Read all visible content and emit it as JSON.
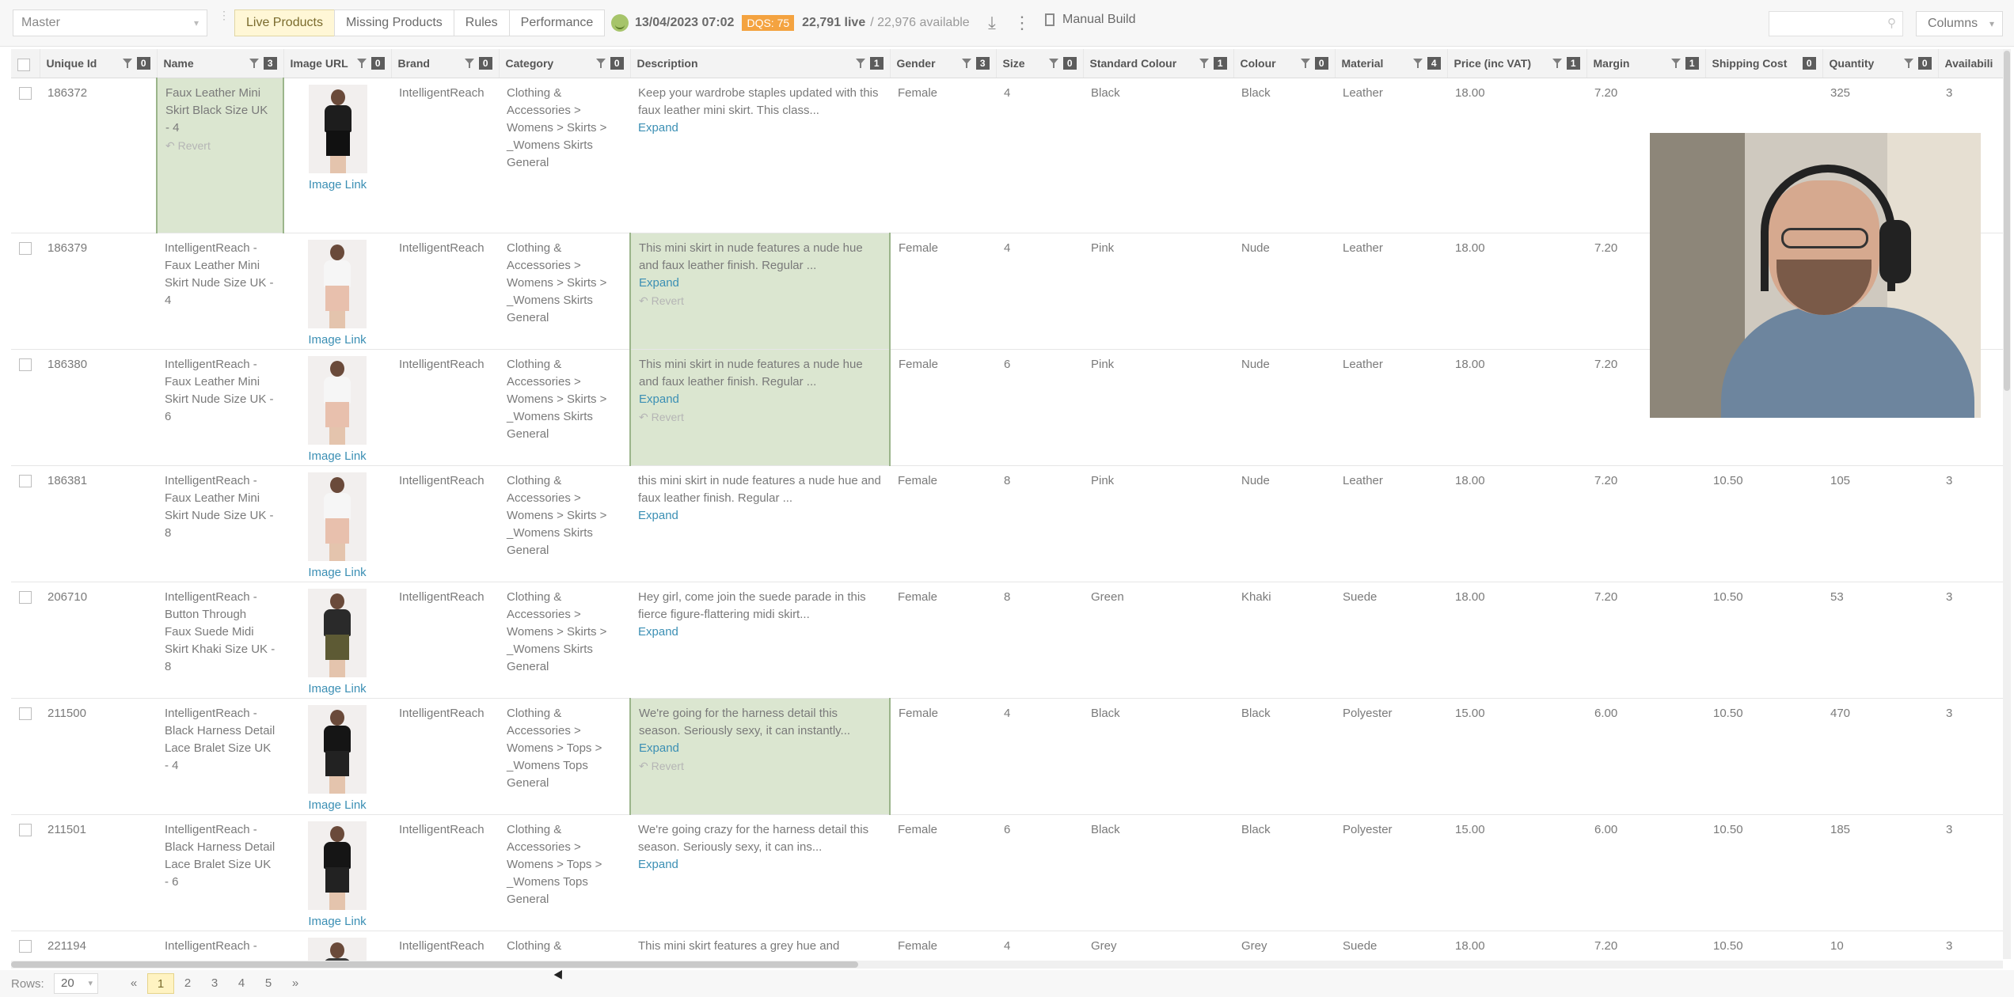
{
  "toolbar": {
    "master_select": "Master",
    "tabs": [
      "Live Products",
      "Missing Products",
      "Rules",
      "Performance"
    ],
    "status_date": "13/04/2023 07:02",
    "dqs": "DQS: 75",
    "live_count": "22,791 live",
    "available_text": "/ 22,976 available",
    "manual_build": "Manual Build",
    "search_placeholder": "",
    "columns_label": "Columns"
  },
  "columns": [
    {
      "label": "Unique Id",
      "badge": "0"
    },
    {
      "label": "Name",
      "badge": "3"
    },
    {
      "label": "Image URL",
      "badge": "0"
    },
    {
      "label": "Brand",
      "badge": "0"
    },
    {
      "label": "Category",
      "badge": "0"
    },
    {
      "label": "Description",
      "badge": "1"
    },
    {
      "label": "Gender",
      "badge": "3"
    },
    {
      "label": "Size",
      "badge": "0"
    },
    {
      "label": "Standard Colour",
      "badge": "1"
    },
    {
      "label": "Colour",
      "badge": "0"
    },
    {
      "label": "Material",
      "badge": "4"
    },
    {
      "label": "Price (inc VAT)",
      "badge": "1"
    },
    {
      "label": "Margin",
      "badge": "1"
    },
    {
      "label": "Shipping Cost",
      "badge": "0"
    },
    {
      "label": "Quantity",
      "badge": "0"
    },
    {
      "label": "Availabili",
      "badge": ""
    }
  ],
  "rows": [
    {
      "id": "186372",
      "name": "Faux Leather Mini Skirt Black Size UK - 4",
      "name_revert": "↶ Revert",
      "image_link": "Image Link",
      "brand": "IntelligentReach",
      "category": "Clothing & Accessories > Womens > Skirts > _Womens Skirts General",
      "description": "Keep your wardrobe staples updated with this faux leather mini skirt. This class...",
      "desc_expand": "Expand",
      "desc_revert": "",
      "gender": "Female",
      "size": "4",
      "std_colour": "Black",
      "colour": "Black",
      "material": "Leather",
      "price": "18.00",
      "margin": "7.20",
      "shipping": "",
      "quantity": "325",
      "availability": "3",
      "img_top": "#1d1d1d",
      "img_skirt": "#111111"
    },
    {
      "id": "186379",
      "name": "IntelligentReach - Faux Leather Mini Skirt Nude Size UK - 4",
      "name_revert": "",
      "image_link": "Image Link",
      "brand": "IntelligentReach",
      "category": "Clothing & Accessories > Womens > Skirts > _Womens Skirts General",
      "description": "This mini skirt in nude features a nude hue and faux leather finish.   Regular ...",
      "desc_expand": "Expand",
      "desc_revert": "↶ Revert",
      "gender": "Female",
      "size": "4",
      "std_colour": "Pink",
      "colour": "Nude",
      "material": "Leather",
      "price": "18.00",
      "margin": "7.20",
      "shipping": "",
      "quantity": "",
      "availability": "",
      "img_top": "#f6f6f6",
      "img_skirt": "#e8c0ad"
    },
    {
      "id": "186380",
      "name": "IntelligentReach - Faux Leather Mini Skirt Nude Size UK - 6",
      "name_revert": "",
      "image_link": "Image Link",
      "brand": "IntelligentReach",
      "category": "Clothing & Accessories > Womens > Skirts > _Womens Skirts General",
      "description": "This mini skirt in nude features a nude hue and faux leather finish.   Regular ...",
      "desc_expand": "Expand",
      "desc_revert": "↶ Revert",
      "gender": "Female",
      "size": "6",
      "std_colour": "Pink",
      "colour": "Nude",
      "material": "Leather",
      "price": "18.00",
      "margin": "7.20",
      "shipping": "",
      "quantity": "",
      "availability": "",
      "img_top": "#f6f6f6",
      "img_skirt": "#e8c0ad"
    },
    {
      "id": "186381",
      "name": "IntelligentReach - Faux Leather Mini Skirt Nude Size UK - 8",
      "name_revert": "",
      "image_link": "Image Link",
      "brand": "IntelligentReach",
      "category": "Clothing & Accessories > Womens > Skirts > _Womens Skirts General",
      "description": "this mini skirt in nude features a nude hue and faux leather finish.   Regular ...",
      "desc_expand": "Expand",
      "desc_revert": "",
      "gender": "Female",
      "size": "8",
      "std_colour": "Pink",
      "colour": "Nude",
      "material": "Leather",
      "price": "18.00",
      "margin": "7.20",
      "shipping": "10.50",
      "quantity": "105",
      "availability": "3",
      "img_top": "#f6f6f6",
      "img_skirt": "#e8c0ad"
    },
    {
      "id": "206710",
      "name": "IntelligentReach - Button Through Faux Suede Midi Skirt Khaki Size UK - 8",
      "name_revert": "",
      "image_link": "Image Link",
      "brand": "IntelligentReach",
      "category": "Clothing & Accessories > Womens > Skirts > _Womens Skirts General",
      "description": "Hey girl, come join the suede parade in this fierce figure-flattering midi skirt...",
      "desc_expand": "Expand",
      "desc_revert": "",
      "gender": "Female",
      "size": "8",
      "std_colour": "Green",
      "colour": "Khaki",
      "material": "Suede",
      "price": "18.00",
      "margin": "7.20",
      "shipping": "10.50",
      "quantity": "53",
      "availability": "3",
      "img_top": "#2a2a2a",
      "img_skirt": "#5d5a34"
    },
    {
      "id": "211500",
      "name": "IntelligentReach - Black Harness Detail Lace Bralet Size UK - 4",
      "name_revert": "",
      "image_link": "Image Link",
      "brand": "IntelligentReach",
      "category": "Clothing & Accessories > Womens > Tops > _Womens Tops General",
      "description": "We're going for the harness detail this season. Seriously sexy, it can instantly...",
      "desc_expand": "Expand",
      "desc_revert": "↶ Revert",
      "gender": "Female",
      "size": "4",
      "std_colour": "Black",
      "colour": "Black",
      "material": "Polyester",
      "price": "15.00",
      "margin": "6.00",
      "shipping": "10.50",
      "quantity": "470",
      "availability": "3",
      "img_top": "#151515",
      "img_skirt": "#222222"
    },
    {
      "id": "211501",
      "name": "IntelligentReach - Black Harness Detail Lace Bralet Size UK - 6",
      "name_revert": "",
      "image_link": "Image Link",
      "brand": "IntelligentReach",
      "category": "Clothing & Accessories > Womens > Tops > _Womens Tops General",
      "description": "We're going crazy for the harness detail this season. Seriously sexy, it can ins...",
      "desc_expand": "Expand",
      "desc_revert": "",
      "gender": "Female",
      "size": "6",
      "std_colour": "Black",
      "colour": "Black",
      "material": "Polyester",
      "price": "15.00",
      "margin": "6.00",
      "shipping": "10.50",
      "quantity": "185",
      "availability": "3",
      "img_top": "#151515",
      "img_skirt": "#222222"
    },
    {
      "id": "221194",
      "name": "IntelligentReach -",
      "name_revert": "",
      "image_link": "",
      "brand": "IntelligentReach",
      "category": "Clothing &",
      "description": "This mini skirt features a grey hue and",
      "desc_expand": "",
      "desc_revert": "",
      "gender": "Female",
      "size": "4",
      "std_colour": "Grey",
      "colour": "Grey",
      "material": "Suede",
      "price": "18.00",
      "margin": "7.20",
      "shipping": "10.50",
      "quantity": "10",
      "availability": "3",
      "img_top": "#3a3a3a",
      "img_skirt": "#7d7d7d"
    }
  ],
  "highlights": {
    "name_rows": [
      0
    ],
    "description_rows": [
      1,
      2,
      5
    ]
  },
  "footer": {
    "rows_label": "Rows:",
    "rows_value": "20",
    "prev": "«",
    "pages": [
      "1",
      "2",
      "3",
      "4",
      "5"
    ],
    "next": "»"
  },
  "colors": {
    "active_tab": "#fff7d6",
    "dqs_badge": "#f4a340",
    "highlight_cell": "#dbe6d0",
    "link": "#3b8fb4"
  }
}
